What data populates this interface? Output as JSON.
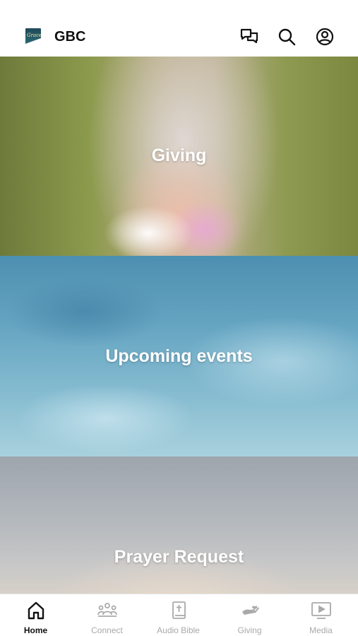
{
  "header": {
    "logo_text": "Grace",
    "title": "GBC",
    "icons": [
      "chat-icon",
      "search-icon",
      "profile-icon"
    ]
  },
  "cards": [
    {
      "title": "Giving"
    },
    {
      "title": "Upcoming events"
    },
    {
      "title": "Prayer Request"
    }
  ],
  "tabbar": {
    "tabs": [
      {
        "label": "Home",
        "icon": "home-icon",
        "active": true
      },
      {
        "label": "Connect",
        "icon": "people-icon",
        "active": false
      },
      {
        "label": "Audio Bible",
        "icon": "bible-icon",
        "active": false
      },
      {
        "label": "Giving",
        "icon": "giving-hand-icon",
        "active": false
      },
      {
        "label": "Media",
        "icon": "media-play-icon",
        "active": false
      }
    ]
  },
  "colors": {
    "active": "#111111",
    "inactive": "#a9a9a9",
    "background": "#ffffff"
  }
}
